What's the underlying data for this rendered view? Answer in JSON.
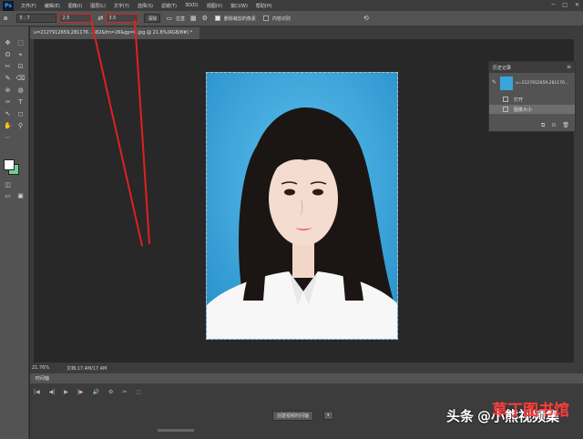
{
  "app": {
    "logo": "Ps"
  },
  "menu": [
    "文件(F)",
    "编辑(E)",
    "图像(I)",
    "图层(L)",
    "文字(Y)",
    "选择(S)",
    "滤镜(T)",
    "3D(D)",
    "视图(V)",
    "窗口(W)",
    "帮助(H)"
  ],
  "window_controls": [
    "─",
    "□",
    "✕"
  ],
  "options": {
    "ratio_value": "5 : 7",
    "width_value": "2.5",
    "swap_icon": "⇄",
    "height_value": "3.5",
    "clear_label": "清除",
    "straighten_label": "拉直",
    "delete_cropped_label": "删除裁剪的像素",
    "content_aware_label": "内容识别",
    "undo_icon": "⟲"
  },
  "document": {
    "tab_title": "u=2127912659,281176…582&fm=26&gp=0.jpg @ 21.8%(RGB/8#) *",
    "zoom": "21.76%",
    "doc_info": "文档:17.4M/17.4M"
  },
  "history": {
    "title": "历史记录",
    "menu_icon": "≡",
    "snapshot_label": "u=2127912659,281176…",
    "items": [
      {
        "label": "打开",
        "active": false
      },
      {
        "label": "图像大小",
        "active": true
      }
    ],
    "footer_icons": [
      "⧉",
      "⊙",
      "🗑"
    ]
  },
  "timeline": {
    "tab_label": "时间轴",
    "create_button": "创建视频时间轴",
    "dropdown_icon": "▾",
    "controls": [
      "|◀",
      "◀|",
      "▶",
      "|▶",
      "🔊",
      "⚙",
      "✂",
      "⬚"
    ]
  },
  "tools": [
    "✥",
    "⬚",
    "ʘ",
    "⌖",
    "✂",
    "⊡",
    "✎",
    "⌫",
    "⊛",
    "◍",
    "✑",
    "T",
    "↖",
    "◻",
    "✋",
    "⚲",
    "⋯"
  ],
  "watermark": {
    "brand": "头条",
    "at": "@小熊视频集",
    "site": "草丁图书馆"
  },
  "colors": {
    "photo_bg": "#3aa5dc",
    "foreground": "#ffffff",
    "background": "#6fd08c",
    "highlight": "#e02020"
  }
}
